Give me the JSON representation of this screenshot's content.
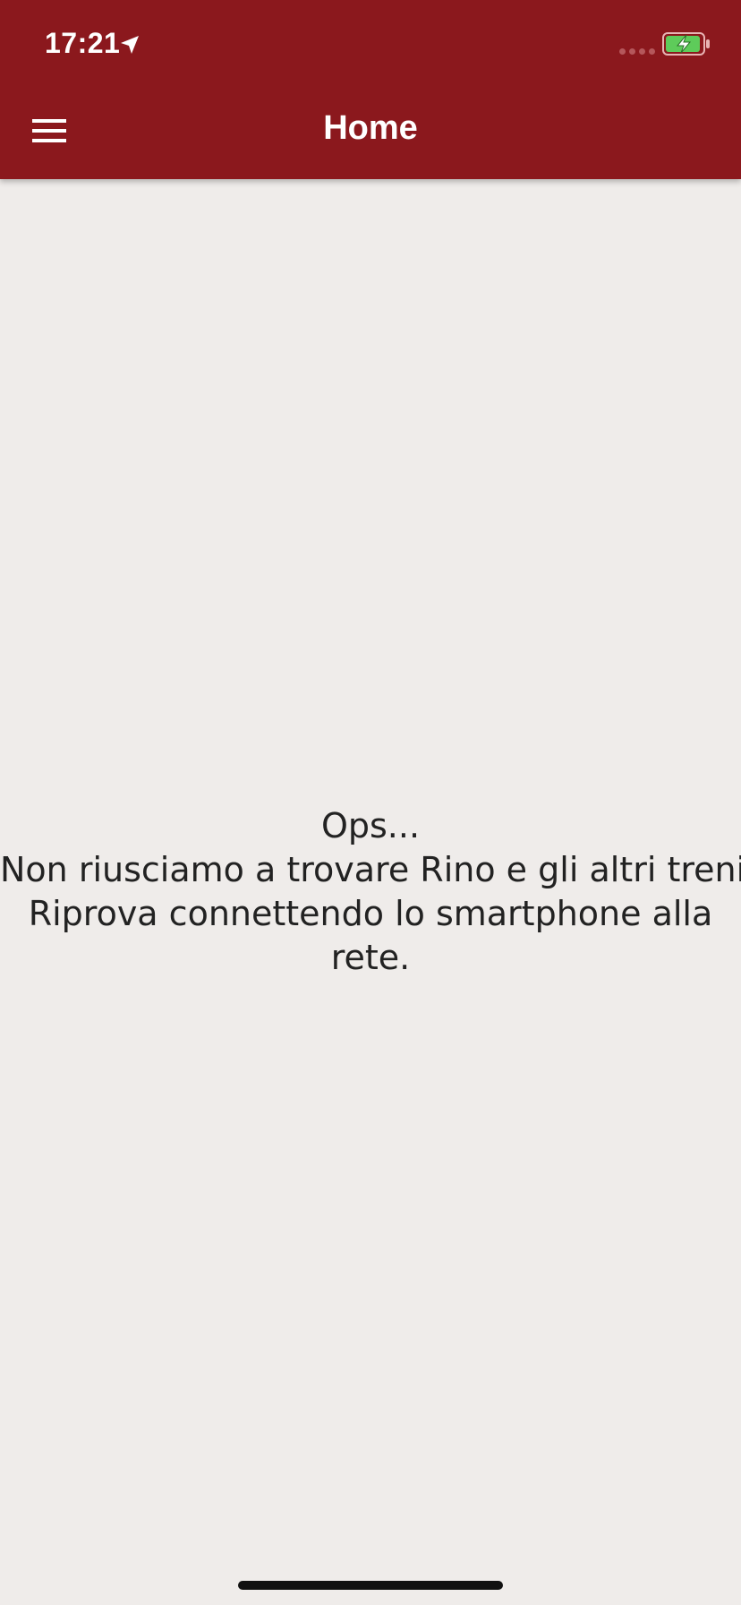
{
  "status_bar": {
    "time": "17:21",
    "location_icon": "location-arrow-icon",
    "signal_icon": "signal-dots-icon",
    "battery_icon": "battery-charging-icon",
    "battery_level": 0.85,
    "battery_color": "#5ecb5a"
  },
  "app_bar": {
    "title": "Home",
    "menu_icon": "hamburger-menu-icon",
    "background_color": "#8b181d"
  },
  "main": {
    "message_lines": [
      "Ops...",
      "Non riusciamo a trovare Rino e gli altri treni.",
      "Riprova connettendo lo smartphone alla",
      "rete."
    ],
    "background_color": "#efecea"
  }
}
